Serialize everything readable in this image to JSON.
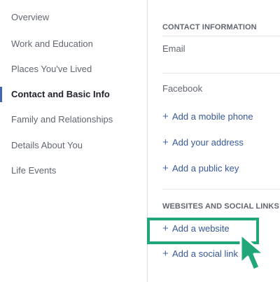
{
  "sidebar": {
    "items": [
      {
        "label": "Overview"
      },
      {
        "label": "Work and Education"
      },
      {
        "label": "Places You've Lived"
      },
      {
        "label": "Contact and Basic Info",
        "active": true
      },
      {
        "label": "Family and Relationships"
      },
      {
        "label": "Details About You"
      },
      {
        "label": "Life Events"
      }
    ]
  },
  "contact": {
    "section_title": "CONTACT INFORMATION",
    "email_label": "Email",
    "facebook_label": "Facebook",
    "add_mobile": "Add a mobile phone",
    "add_address": "Add your address",
    "add_key": "Add a public key"
  },
  "websites": {
    "section_title": "WEBSITES AND SOCIAL LINKS",
    "add_website": "Add a website",
    "add_social": "Add a social link"
  },
  "colors": {
    "highlight": "#21a67a",
    "link": "#365899",
    "active_bar": "#4267b2"
  },
  "icons": {
    "plus": "+",
    "cursor": "pointer-arrow-icon"
  }
}
